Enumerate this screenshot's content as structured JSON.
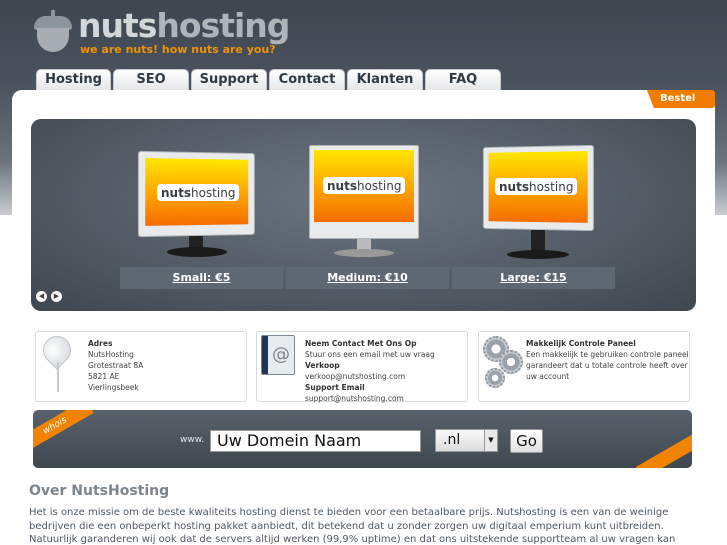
{
  "brand": {
    "name_prefix": "nuts",
    "name_suffix": "hosting",
    "tagline": "we are nuts! how nuts are you?",
    "accent_color": "#f08400"
  },
  "nav": {
    "tabs": [
      {
        "label": "Hosting"
      },
      {
        "label": "SEO"
      },
      {
        "label": "Support"
      },
      {
        "label": "Contact"
      },
      {
        "label": "Klanten"
      },
      {
        "label": "FAQ"
      }
    ]
  },
  "order_button": {
    "label": "Bestel"
  },
  "slider": {
    "monitor_logo_prefix": "nuts",
    "monitor_logo_suffix": "hosting",
    "plans": [
      {
        "label": "Small: €5"
      },
      {
        "label": "Medium: €10"
      },
      {
        "label": "Large: €15"
      }
    ],
    "prev_icon": "arrow-left-icon",
    "next_icon": "arrow-right-icon"
  },
  "info": {
    "address": {
      "title": "Adres",
      "lines": [
        "NutsHosting",
        "Grotestraat 8A",
        "5821 AE",
        "Vierlingsbeek"
      ],
      "icon": "map-pin-icon"
    },
    "contact": {
      "title": "Neem Contact Met Ons Op",
      "intro": "Stuur ons een email met uw vraag",
      "sales_title": "Verkoop",
      "sales_email": "verkoop@nutshosting.com",
      "support_title": "Support Email",
      "support_email": "support@nutshosting.com",
      "icon": "address-book-icon"
    },
    "panel": {
      "title": "Makkelijk Controle Paneel",
      "lines": [
        "Een makkelijk te gebruiken controle paneel",
        "garandeert dat u totale controle heeft over",
        "uw account"
      ],
      "icon": "gears-icon"
    }
  },
  "whois": {
    "ribbon": "whois",
    "prefix": "www.",
    "domain_value": "Uw Domein Naam",
    "tld_value": ".nl",
    "go_label": "Go"
  },
  "about": {
    "heading": "Over NutsHosting",
    "lines": [
      "Het is onze missie om de beste kwaliteits hosting dienst te bieden voor een betaalbare prijs. Nutshosting is een van de weinige",
      "bedrijven die een onbeperkt hosting pakket aanbiedt, dit betekend dat u zonder zorgen uw digitaal emperium kunt uitbreiden.",
      "Natuurlijk garanderen wij ook dat de servers altijd werken (99,9% uptime) en dat ons uitstekende supportteam al uw vragen kan"
    ]
  }
}
